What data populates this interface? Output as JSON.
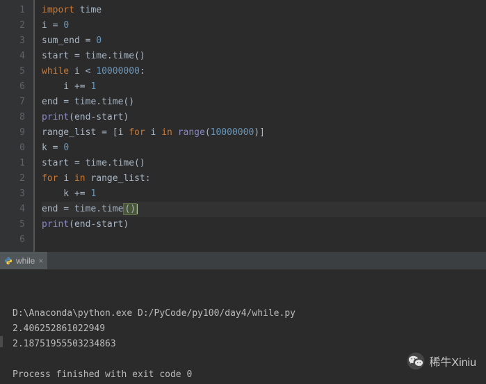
{
  "editor": {
    "lines": [
      {
        "num": "1",
        "tokens": [
          {
            "t": "import ",
            "c": "kw"
          },
          {
            "t": "time",
            "c": ""
          }
        ]
      },
      {
        "num": "2",
        "tokens": [
          {
            "t": "i = ",
            "c": ""
          },
          {
            "t": "0",
            "c": "num"
          }
        ]
      },
      {
        "num": "3",
        "tokens": [
          {
            "t": "sum_end = ",
            "c": ""
          },
          {
            "t": "0",
            "c": "num"
          }
        ]
      },
      {
        "num": "4",
        "tokens": [
          {
            "t": "start = time.time()",
            "c": ""
          }
        ]
      },
      {
        "num": "5",
        "tokens": [
          {
            "t": "while ",
            "c": "kw"
          },
          {
            "t": "i < ",
            "c": ""
          },
          {
            "t": "10000000",
            "c": "num"
          },
          {
            "t": ":",
            "c": ""
          }
        ]
      },
      {
        "num": "6",
        "tokens": [
          {
            "t": "    i += ",
            "c": ""
          },
          {
            "t": "1",
            "c": "num"
          }
        ]
      },
      {
        "num": "7",
        "tokens": [
          {
            "t": "end = time.time()",
            "c": ""
          }
        ]
      },
      {
        "num": "8",
        "tokens": [
          {
            "t": "print",
            "c": "builtin"
          },
          {
            "t": "(end-start)",
            "c": ""
          }
        ]
      },
      {
        "num": "9",
        "tokens": [
          {
            "t": "range_list = [i ",
            "c": ""
          },
          {
            "t": "for ",
            "c": "kw"
          },
          {
            "t": "i ",
            "c": ""
          },
          {
            "t": "in ",
            "c": "kw"
          },
          {
            "t": "range",
            "c": "builtin"
          },
          {
            "t": "(",
            "c": ""
          },
          {
            "t": "10000000",
            "c": "num"
          },
          {
            "t": ")]",
            "c": ""
          }
        ]
      },
      {
        "num": "0",
        "tokens": [
          {
            "t": "k = ",
            "c": ""
          },
          {
            "t": "0",
            "c": "num"
          }
        ]
      },
      {
        "num": "1",
        "tokens": [
          {
            "t": "start = time.time()",
            "c": ""
          }
        ]
      },
      {
        "num": "2",
        "tokens": [
          {
            "t": "for ",
            "c": "kw"
          },
          {
            "t": "i ",
            "c": ""
          },
          {
            "t": "in ",
            "c": "kw"
          },
          {
            "t": "range_list:",
            "c": ""
          }
        ]
      },
      {
        "num": "3",
        "tokens": [
          {
            "t": "    k += ",
            "c": ""
          },
          {
            "t": "1",
            "c": "num"
          }
        ]
      },
      {
        "num": "4",
        "tokens": [
          {
            "t": "end = time.time",
            "c": ""
          }
        ],
        "cursor_suffix": "()",
        "highlight": true
      },
      {
        "num": "5",
        "tokens": [
          {
            "t": "print",
            "c": "builtin"
          },
          {
            "t": "(end-start)",
            "c": ""
          }
        ]
      },
      {
        "num": "6",
        "tokens": []
      }
    ]
  },
  "tab": {
    "label": "while",
    "close": "×"
  },
  "console": {
    "lines": [
      "D:\\Anaconda\\python.exe D:/PyCode/py100/day4/while.py",
      "2.406252861022949",
      "2.18751955503234863",
      "",
      "Process finished with exit code 0"
    ]
  },
  "watermark": {
    "text": "稀牛Xiniu"
  }
}
